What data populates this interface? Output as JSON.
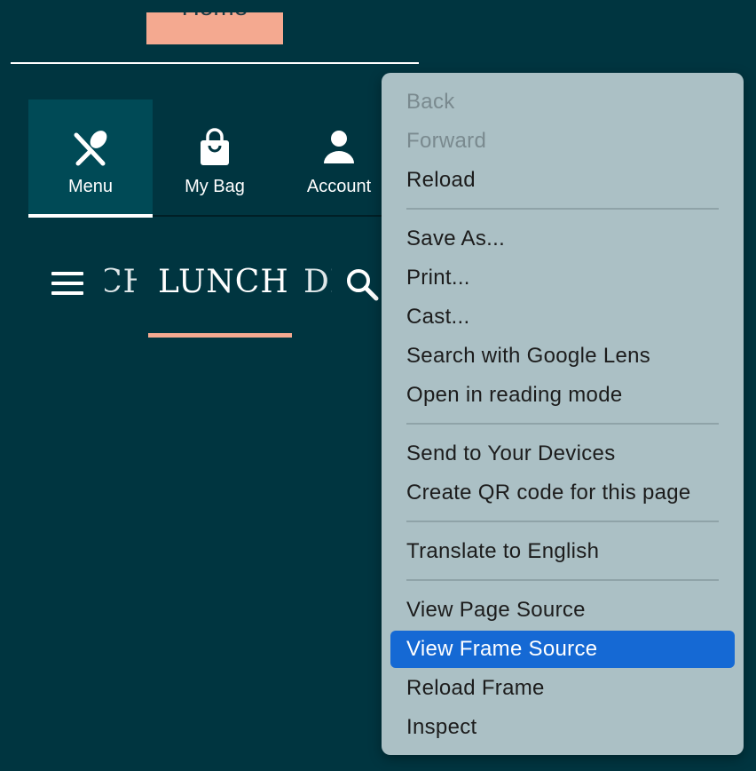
{
  "page": {
    "home_label": "Home",
    "nav": [
      {
        "label": "Menu",
        "icon": "utensils-icon"
      },
      {
        "label": "My Bag",
        "icon": "bag-icon"
      },
      {
        "label": "Account",
        "icon": "person-icon"
      }
    ],
    "categories": {
      "left_partial": "CH",
      "active": "LUNCH",
      "right_partial": "DI"
    }
  },
  "context_menu": {
    "items": [
      {
        "label": "Back",
        "state": "disabled"
      },
      {
        "label": "Forward",
        "state": "disabled"
      },
      {
        "label": "Reload",
        "state": "normal"
      },
      {
        "label": "Save As...",
        "state": "normal"
      },
      {
        "label": "Print...",
        "state": "normal"
      },
      {
        "label": "Cast...",
        "state": "normal"
      },
      {
        "label": "Search with Google Lens",
        "state": "normal"
      },
      {
        "label": "Open in reading mode",
        "state": "normal"
      },
      {
        "label": "Send to Your Devices",
        "state": "normal"
      },
      {
        "label": "Create QR code for this page",
        "state": "normal"
      },
      {
        "label": "Translate to English",
        "state": "normal"
      },
      {
        "label": "View Page Source",
        "state": "normal"
      },
      {
        "label": "View Frame Source",
        "state": "selected"
      },
      {
        "label": "Reload Frame",
        "state": "normal"
      },
      {
        "label": "Inspect",
        "state": "normal"
      }
    ]
  },
  "colors": {
    "background": "#003540",
    "accent": "#f4a990",
    "menu_bg": "#abc0c5",
    "selection": "#1569d4"
  }
}
